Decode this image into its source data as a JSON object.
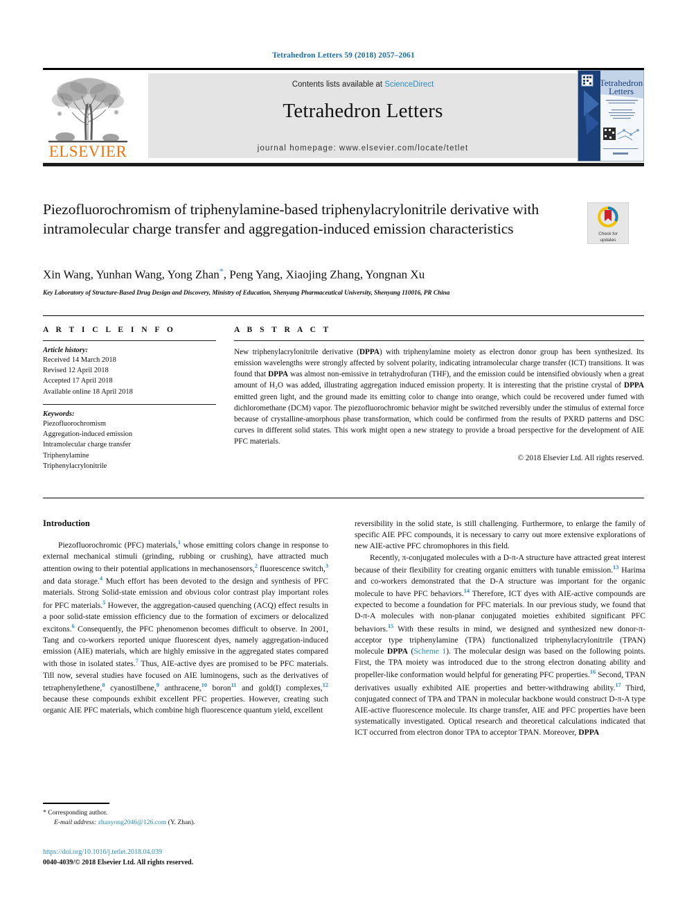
{
  "running_head": "Tetrahedron Letters 59 (2018) 2057–2061",
  "masthead": {
    "contents_prefix": "Contents lists available at ",
    "sciencedirect": "ScienceDirect",
    "journal_title": "Tetrahedron Letters",
    "homepage": "journal homepage: www.elsevier.com/locate/tetlet",
    "publisher_logo_text": "ELSEVIER",
    "cover_title_line1": "Tetrahedron",
    "cover_title_line2": "Letters"
  },
  "crossmark": {
    "line1": "Check for",
    "line2": "updates"
  },
  "article": {
    "title": "Piezofluorochromism of triphenylamine-based triphenylacrylonitrile derivative with intramolecular charge transfer and aggregation-induced emission characteristics",
    "authors": "Xin Wang, Yunhan Wang, Yong Zhan",
    "authors_rest": ", Peng Yang, Xiaojing Zhang, Yongnan Xu",
    "corresponding_marker": "*",
    "affiliation": "Key Laboratory of Structure-Based Drug Design and Discovery, Ministry of Education, Shenyang Pharmaceutical University, Shenyang 110016, PR China"
  },
  "article_info": {
    "heading": "A R T I C L E   I N F O",
    "history_label": "Article history:",
    "history": [
      "Received 14 March 2018",
      "Revised 12 April 2018",
      "Accepted 17 April 2018",
      "Available online 18 April 2018"
    ],
    "keywords_label": "Keywords:",
    "keywords": [
      "Piezofluorochromism",
      "Aggregation-induced emission",
      "Intramolecular charge transfer",
      "Triphenylamine",
      "Triphenylacrylonitrile"
    ]
  },
  "abstract": {
    "heading": "A B S T R A C T",
    "part1": "New triphenylacrylonitrile derivative (",
    "cmpd1": "DPPA",
    "part2": ") with triphenylamine moiety as electron donor group has been synthesized. Its emission wavelengths were strongly affected by solvent polarity, indicating intramolecular charge transfer (ICT) transitions. It was found that ",
    "cmpd2": "DPPA",
    "part3": " was almost non-emissive in tetrahydrofuran (THF), and the emission could be intensified obviously when a great amount of H₂O was added, illustrating aggregation induced emission property. It is interesting that the pristine crystal of ",
    "cmpd3": "DPPA",
    "part4": " emitted green light, and the ground made its emitting color to change into orange, which could be recovered under fumed with dichloromethane (DCM) vapor. The piezofluorochromic behavior might be switched reversibly under the stimulus of external force because of crystalline-amorphous phase transformation, which could be confirmed from the results of PXRD patterns and DSC curves in different solid states. This work might open a new strategy to provide a broad perspective for the development of AIE PFC materials.",
    "copyright": "© 2018 Elsevier Ltd. All rights reserved."
  },
  "body": {
    "section_heading": "Introduction",
    "left_p1_a": "Piezofluorochromic (PFC) materials,",
    "left_p1_r1": "1",
    "left_p1_b": " whose emitting colors change in response to external mechanical stimuli (grinding, rubbing or crushing), have attracted much attention owing to their potential applications in mechanosensors,",
    "left_p1_r2": "2",
    "left_p1_c": " fluorescence switch,",
    "left_p1_r3": "3",
    "left_p1_d": " and data storage.",
    "left_p1_r4": "4",
    "left_p1_e": " Much effort has been devoted to the design and synthesis of PFC materials. Strong Solid-state emission and obvious color contrast play important roles for PFC materials.",
    "left_p1_r5": "5",
    "left_p1_f": " However, the aggregation-caused quenching (ACQ) effect results in a poor solid-state emission efficiency due to the formation of excimers or delocalized excitons.",
    "left_p1_r6": "6",
    "left_p1_g": " Consequently, the PFC phenomenon becomes difficult to observe. In 2001, Tang and co-workers reported unique fluorescent dyes, namely aggregation-induced emission (AIE) materials, which are highly emissive in the aggregated states compared with those in isolated states.",
    "left_p1_r7": "7",
    "left_p1_h": " Thus, AIE-active dyes are promised to be PFC materials. Till now, several studies have focused on AIE luminogens, such as the derivatives of tetraphenylethene,",
    "left_p1_r8": "8",
    "left_p1_i": " cyanostilbene,",
    "left_p1_r9": "9",
    "left_p1_j": " anthracene,",
    "left_p1_r10": "10",
    "left_p1_k": " boron",
    "left_p1_r11": "11",
    "left_p1_l": " and gold(I) complexes,",
    "left_p1_r12": "12",
    "left_p1_m": " because these compounds exhibit excellent PFC properties. However, creating such organic AIE PFC materials, which combine high fluorescence quantum yield, excellent",
    "right_p1_a": "reversibility in the solid state, is still challenging. Furthermore, to enlarge the family of specific AIE PFC compounds, it is necessary to carry out more extensive explorations of new AIE-active PFC chromophores in this field.",
    "right_p2_a": "Recently, π-conjugated molecules with a D-π-A structure have attracted great interest because of their flexibility for creating organic emitters with tunable emission.",
    "right_p2_r13": "13",
    "right_p2_b": " Harima and co-workers demonstrated that the D-A structure was important for the organic molecule to have PFC behaviors.",
    "right_p2_r14": "14",
    "right_p2_c": " Therefore, ICT dyes with AIE-active compounds are expected to become a foundation for PFC materials. In our previous study, we found that D-π-A molecules with non-planar conjugated moieties exhibited significant PFC behaviors.",
    "right_p2_r15": "15",
    "right_p2_d": " With these results in mind, we designed and synthesized new donor-π-acceptor type triphenylamine (TPA) functionalized triphenylacrylonitrile (TPAN) molecule ",
    "right_p2_cmpd": "DPPA",
    "right_p2_e": " (",
    "right_p2_scheme": "Scheme 1",
    "right_p2_f": "). The molecular design was based on the following points. First, the TPA moiety was introduced due to the strong electron donating ability and propeller-like conformation would helpful for generating PFC properties.",
    "right_p2_r16": "16",
    "right_p2_g": " Second, TPAN derivatives usually exhibited AIE properties and better-withdrawing ability.",
    "right_p2_r17": "17",
    "right_p2_h": " Third, conjugated connect of TPA and TPAN in molecular backbone would construct D-π-A type AIE-active fluorescence molecule. Its charge transfer, AIE and PFC properties have been systematically investigated. Optical research and theoretical calculations indicated that ICT occurred from electron donor TPA to acceptor TPAN. Moreover, ",
    "right_p2_cmpd2": "DPPA"
  },
  "footnote": {
    "star": "*",
    "corresponding": "Corresponding author.",
    "email_label": "E-mail address:",
    "email": "zhanyong2046@126.com",
    "email_owner": "(Y. Zhan).",
    "doi": "https://doi.org/10.1016/j.tetlet.2018.04.039",
    "issn": "0040-4039/© 2018 Elsevier Ltd. All rights reserved."
  },
  "colors": {
    "link": "#2b8cbe",
    "elsevier_orange": "#e8740c",
    "band_gray": "#e4e4e4"
  }
}
